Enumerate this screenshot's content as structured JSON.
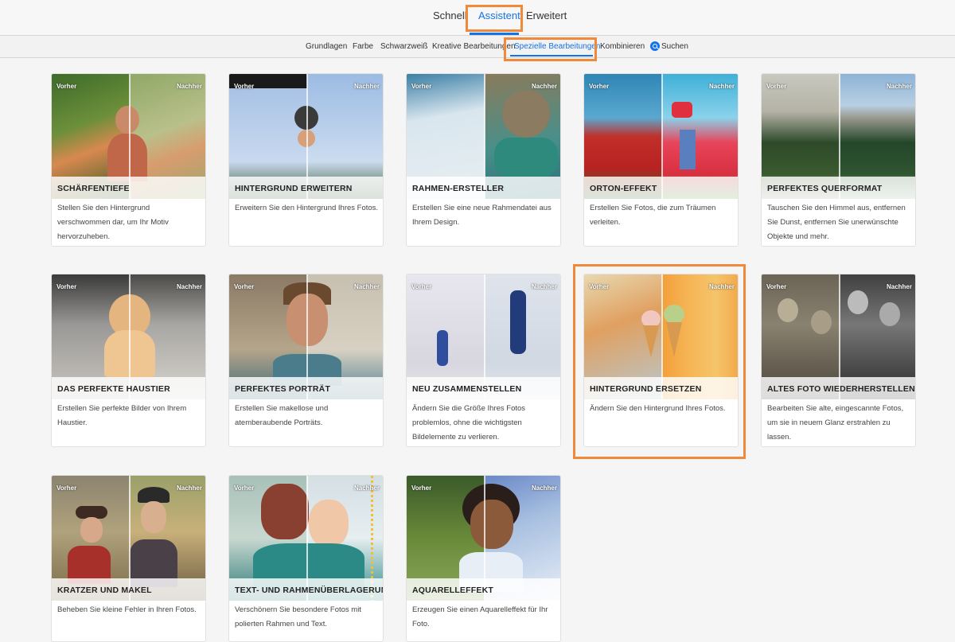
{
  "top_tabs": [
    {
      "label": "Schnell"
    },
    {
      "label": "Assistent"
    },
    {
      "label": "Erweitert"
    }
  ],
  "sub_tabs": [
    {
      "label": "Grundlagen"
    },
    {
      "label": "Farbe"
    },
    {
      "label": "Schwarzweiß"
    },
    {
      "label": "Kreative Bearbeitungen"
    },
    {
      "label": "Spezielle Bearbeitungen"
    },
    {
      "label": "Kombinieren"
    },
    {
      "label": "Suchen"
    }
  ],
  "labels": {
    "before": "Vorher",
    "after": "Nachher"
  },
  "cards": [
    {
      "title": "SCHÄRFENTIEFE",
      "description": "Stellen Sie den Hintergrund verschwommen dar, um Ihr Motiv hervorzuheben."
    },
    {
      "title": "HINTERGRUND ERWEITERN",
      "description": "Erweitern Sie den Hintergrund Ihres Fotos."
    },
    {
      "title": "RAHMEN-ERSTELLER",
      "description": "Erstellen Sie eine neue Rahmendatei aus Ihrem Design."
    },
    {
      "title": "ORTON-EFFEKT",
      "description": "Erstellen Sie Fotos, die zum Träumen verleiten."
    },
    {
      "title": "PERFEKTES QUERFORMAT",
      "description": "Tauschen Sie den Himmel aus, entfernen Sie Dunst, entfernen Sie unerwünschte Objekte und mehr."
    },
    {
      "title": "DAS PERFEKTE HAUSTIER",
      "description": "Erstellen Sie perfekte Bilder von Ihrem Haustier."
    },
    {
      "title": "PERFEKTES PORTRÄT",
      "description": "Erstellen Sie makellose und atemberaubende Porträts."
    },
    {
      "title": "NEU ZUSAMMENSTELLEN",
      "description": "Ändern Sie die Größe Ihres Fotos problemlos, ohne die wichtigsten Bildelemente zu verlieren."
    },
    {
      "title": "HINTERGRUND ERSETZEN",
      "description": "Ändern Sie den Hintergrund Ihres Fotos."
    },
    {
      "title": "ALTES FOTO WIEDERHERSTELLEN",
      "description": "Bearbeiten Sie alte, eingescannte Fotos, um sie in neuem Glanz erstrahlen zu lassen."
    },
    {
      "title": "KRATZER UND MAKEL",
      "description": "Beheben Sie kleine Fehler in Ihren Fotos."
    },
    {
      "title": "TEXT- UND RAHMENÜBERLAGERUNG",
      "description": "Verschönern Sie besondere Fotos mit polierten Rahmen und Text."
    },
    {
      "title": "AQUARELLEFFEKT",
      "description": "Erzeugen Sie einen Aquarelleffekt für Ihr Foto."
    }
  ]
}
